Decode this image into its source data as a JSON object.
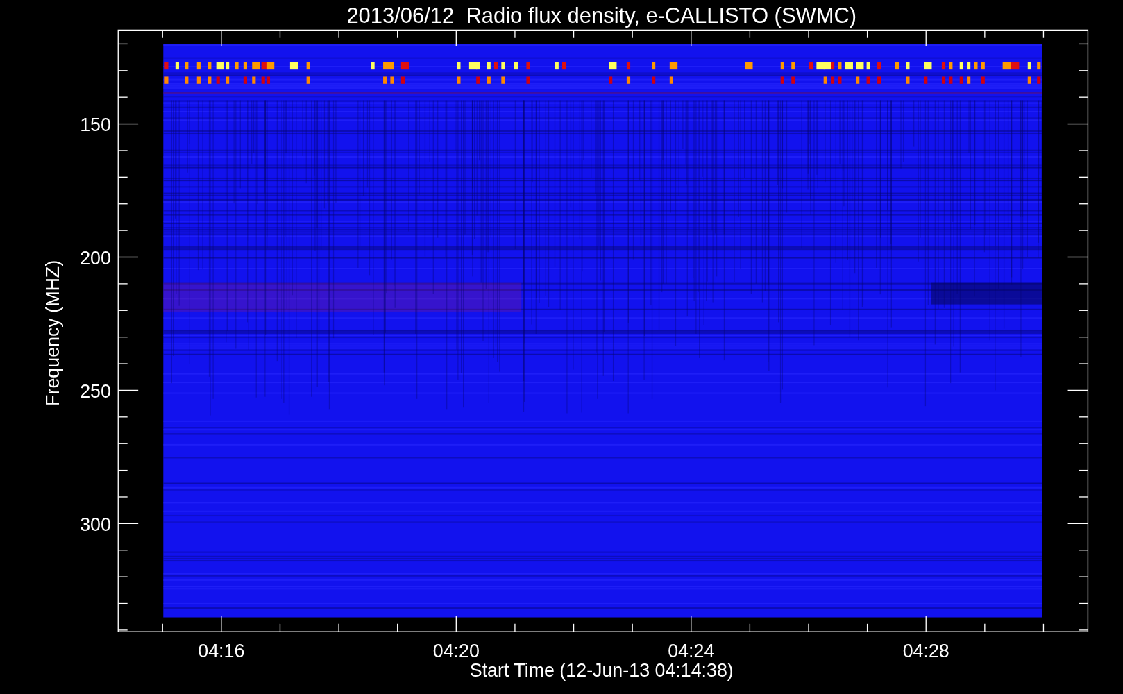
{
  "plot": {
    "title": "2013/06/12  Radio flux density, e-CALLISTO (SWMC)",
    "ylabel": "Frequency (MHZ)",
    "xlabel": "Start Time (12-Jun-13 04:14:38)",
    "yticks": [
      "150",
      "200",
      "250",
      "300"
    ],
    "xticks": [
      "04:16",
      "04:20",
      "04:24",
      "04:28"
    ]
  }
}
